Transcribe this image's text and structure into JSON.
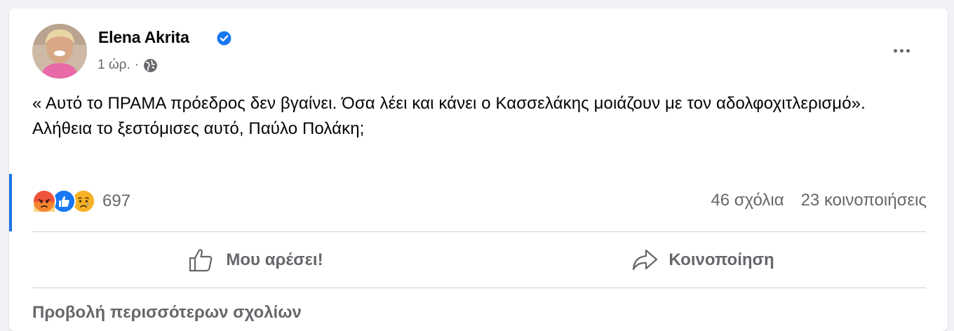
{
  "post": {
    "author": "Elena Akrita",
    "time": "1 ώρ.",
    "dot": "·",
    "text_lines": [
      "« Αυτό το ΠΡΑΜΑ πρόεδρος δεν βγαίνει. Όσα λέει και κάνει ο Κασσελάκης μοιάζουν με τον αδολφοχιτλερισμό».",
      "Αλήθεια το ξεστόμισες αυτό, Παύλο Πολάκη;"
    ],
    "reactions": [
      "angry",
      "like",
      "sad"
    ],
    "reaction_count": "697",
    "comments": "46 σχόλια",
    "shares": "23 κοινοποιήσεις"
  },
  "actions": {
    "like_label": "Μου αρέσει!",
    "share_label": "Κοινοποίηση"
  },
  "footer": {
    "more_comments": "Προβολή περισσότερων σχολίων"
  },
  "icons": {
    "verified": "verified-badge-icon",
    "audience": "globe-icon",
    "more": "more-options-icon",
    "like": "thumbs-up-icon",
    "share": "share-arrow-icon"
  },
  "colors": {
    "accent": "#1b74e4",
    "angry": "#f0533c",
    "like": "#1877f2",
    "sad": "#f7b125",
    "muted": "#65676b"
  }
}
